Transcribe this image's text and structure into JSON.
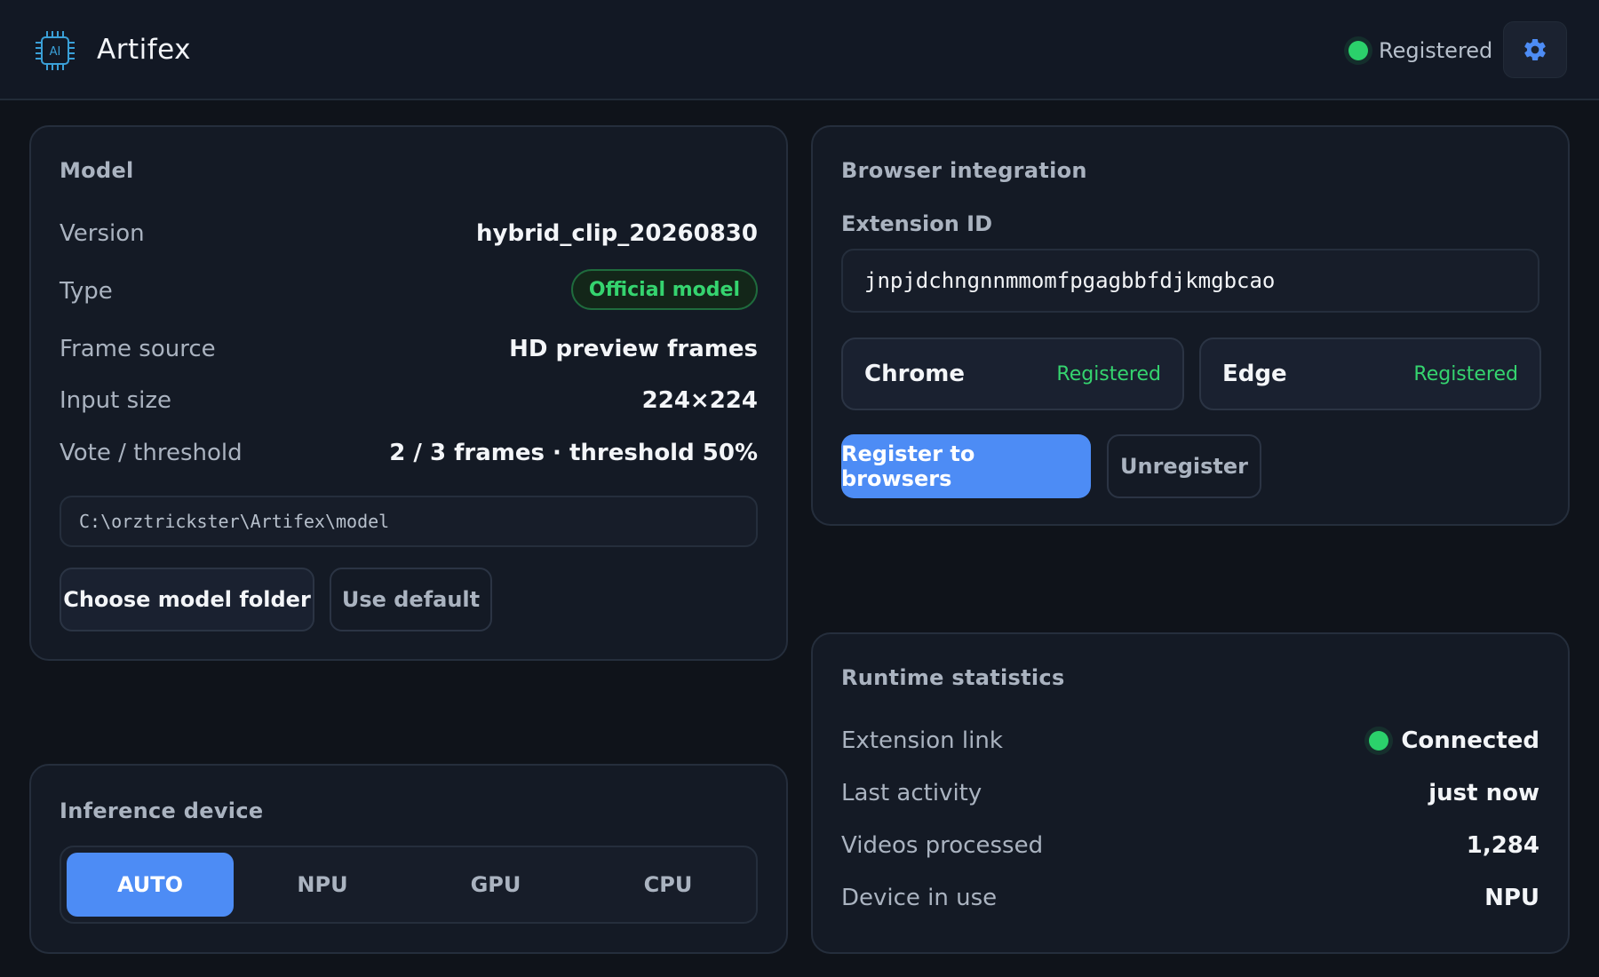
{
  "app": {
    "title": "Artifex",
    "status": "Registered",
    "accent": "#4d8cf5",
    "success": "#2bd16b"
  },
  "model": {
    "title": "Model",
    "version_label": "Version",
    "version_value": "hybrid_clip_20260830",
    "type_label": "Type",
    "type_badge": "Official model",
    "frame_label": "Frame source",
    "frame_value": "HD preview frames",
    "input_label": "Input size",
    "input_value": "224×224",
    "vote_label": "Vote / threshold",
    "vote_value": "2 / 3 frames · threshold 50%",
    "path": "C:\\orztrickster\\Artifex\\model",
    "choose_button": "Choose model folder",
    "default_button": "Use default"
  },
  "inference": {
    "title": "Inference device",
    "options": [
      "AUTO",
      "NPU",
      "GPU",
      "CPU"
    ],
    "selected": "AUTO"
  },
  "browser": {
    "title": "Browser integration",
    "ext_label": "Extension ID",
    "ext_id": "jnpjdchngnnmmomfpgagbbfdjkmgbcao",
    "chrome_name": "Chrome",
    "chrome_status": "Registered",
    "edge_name": "Edge",
    "edge_status": "Registered",
    "register_button": "Register to browsers",
    "unregister_button": "Unregister"
  },
  "runtime": {
    "title": "Runtime statistics",
    "link_label": "Extension link",
    "link_value": "Connected",
    "activity_label": "Last activity",
    "activity_value": "just now",
    "videos_label": "Videos processed",
    "videos_value": "1,284",
    "device_label": "Device in use",
    "device_value": "NPU"
  },
  "icons": {
    "brand": "ai-chip-icon",
    "settings": "gear-icon"
  }
}
